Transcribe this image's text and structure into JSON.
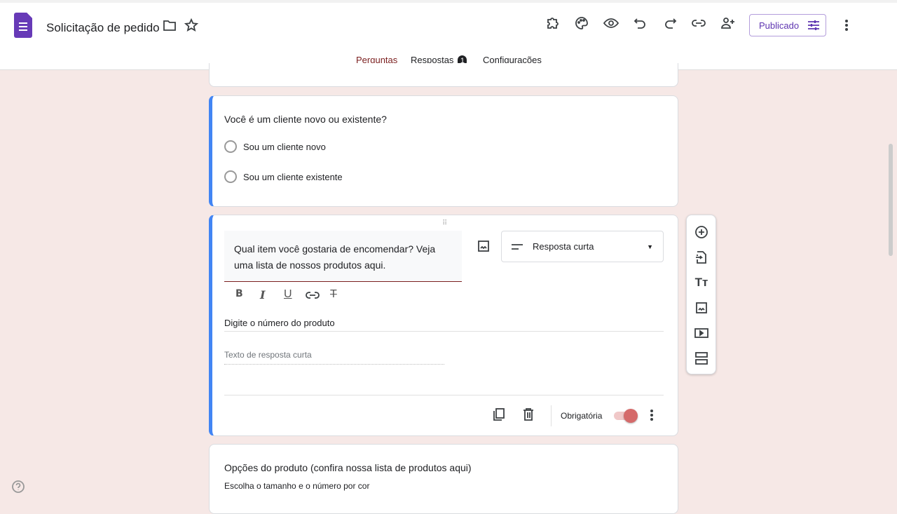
{
  "header": {
    "title": "Solicitação de pedido",
    "publish_label": "Publicado"
  },
  "tabs": [
    {
      "label": "Perguntas"
    },
    {
      "label": "Respostas",
      "badge": "1"
    },
    {
      "label": "Configurações"
    }
  ],
  "q1": {
    "title": "Você é um cliente novo ou existente?",
    "options": [
      "Sou um cliente novo",
      "Sou um cliente existente"
    ]
  },
  "q2": {
    "title": "Qual item você gostaria de encomendar? Veja uma lista de nossos produtos aqui.",
    "type": "Resposta curta",
    "description": "Digite o número do produto",
    "placeholder": "Texto de resposta curta",
    "required_label": "Obrigatória",
    "required": true
  },
  "q3": {
    "title": "Opções do produto (confira nossa lista de produtos aqui)",
    "description": "Escolha o tamanho e o número por cor"
  },
  "colors": {
    "accent": "#4285f4",
    "brand": "#673ab7",
    "active_tab": "#7b1f1f"
  }
}
